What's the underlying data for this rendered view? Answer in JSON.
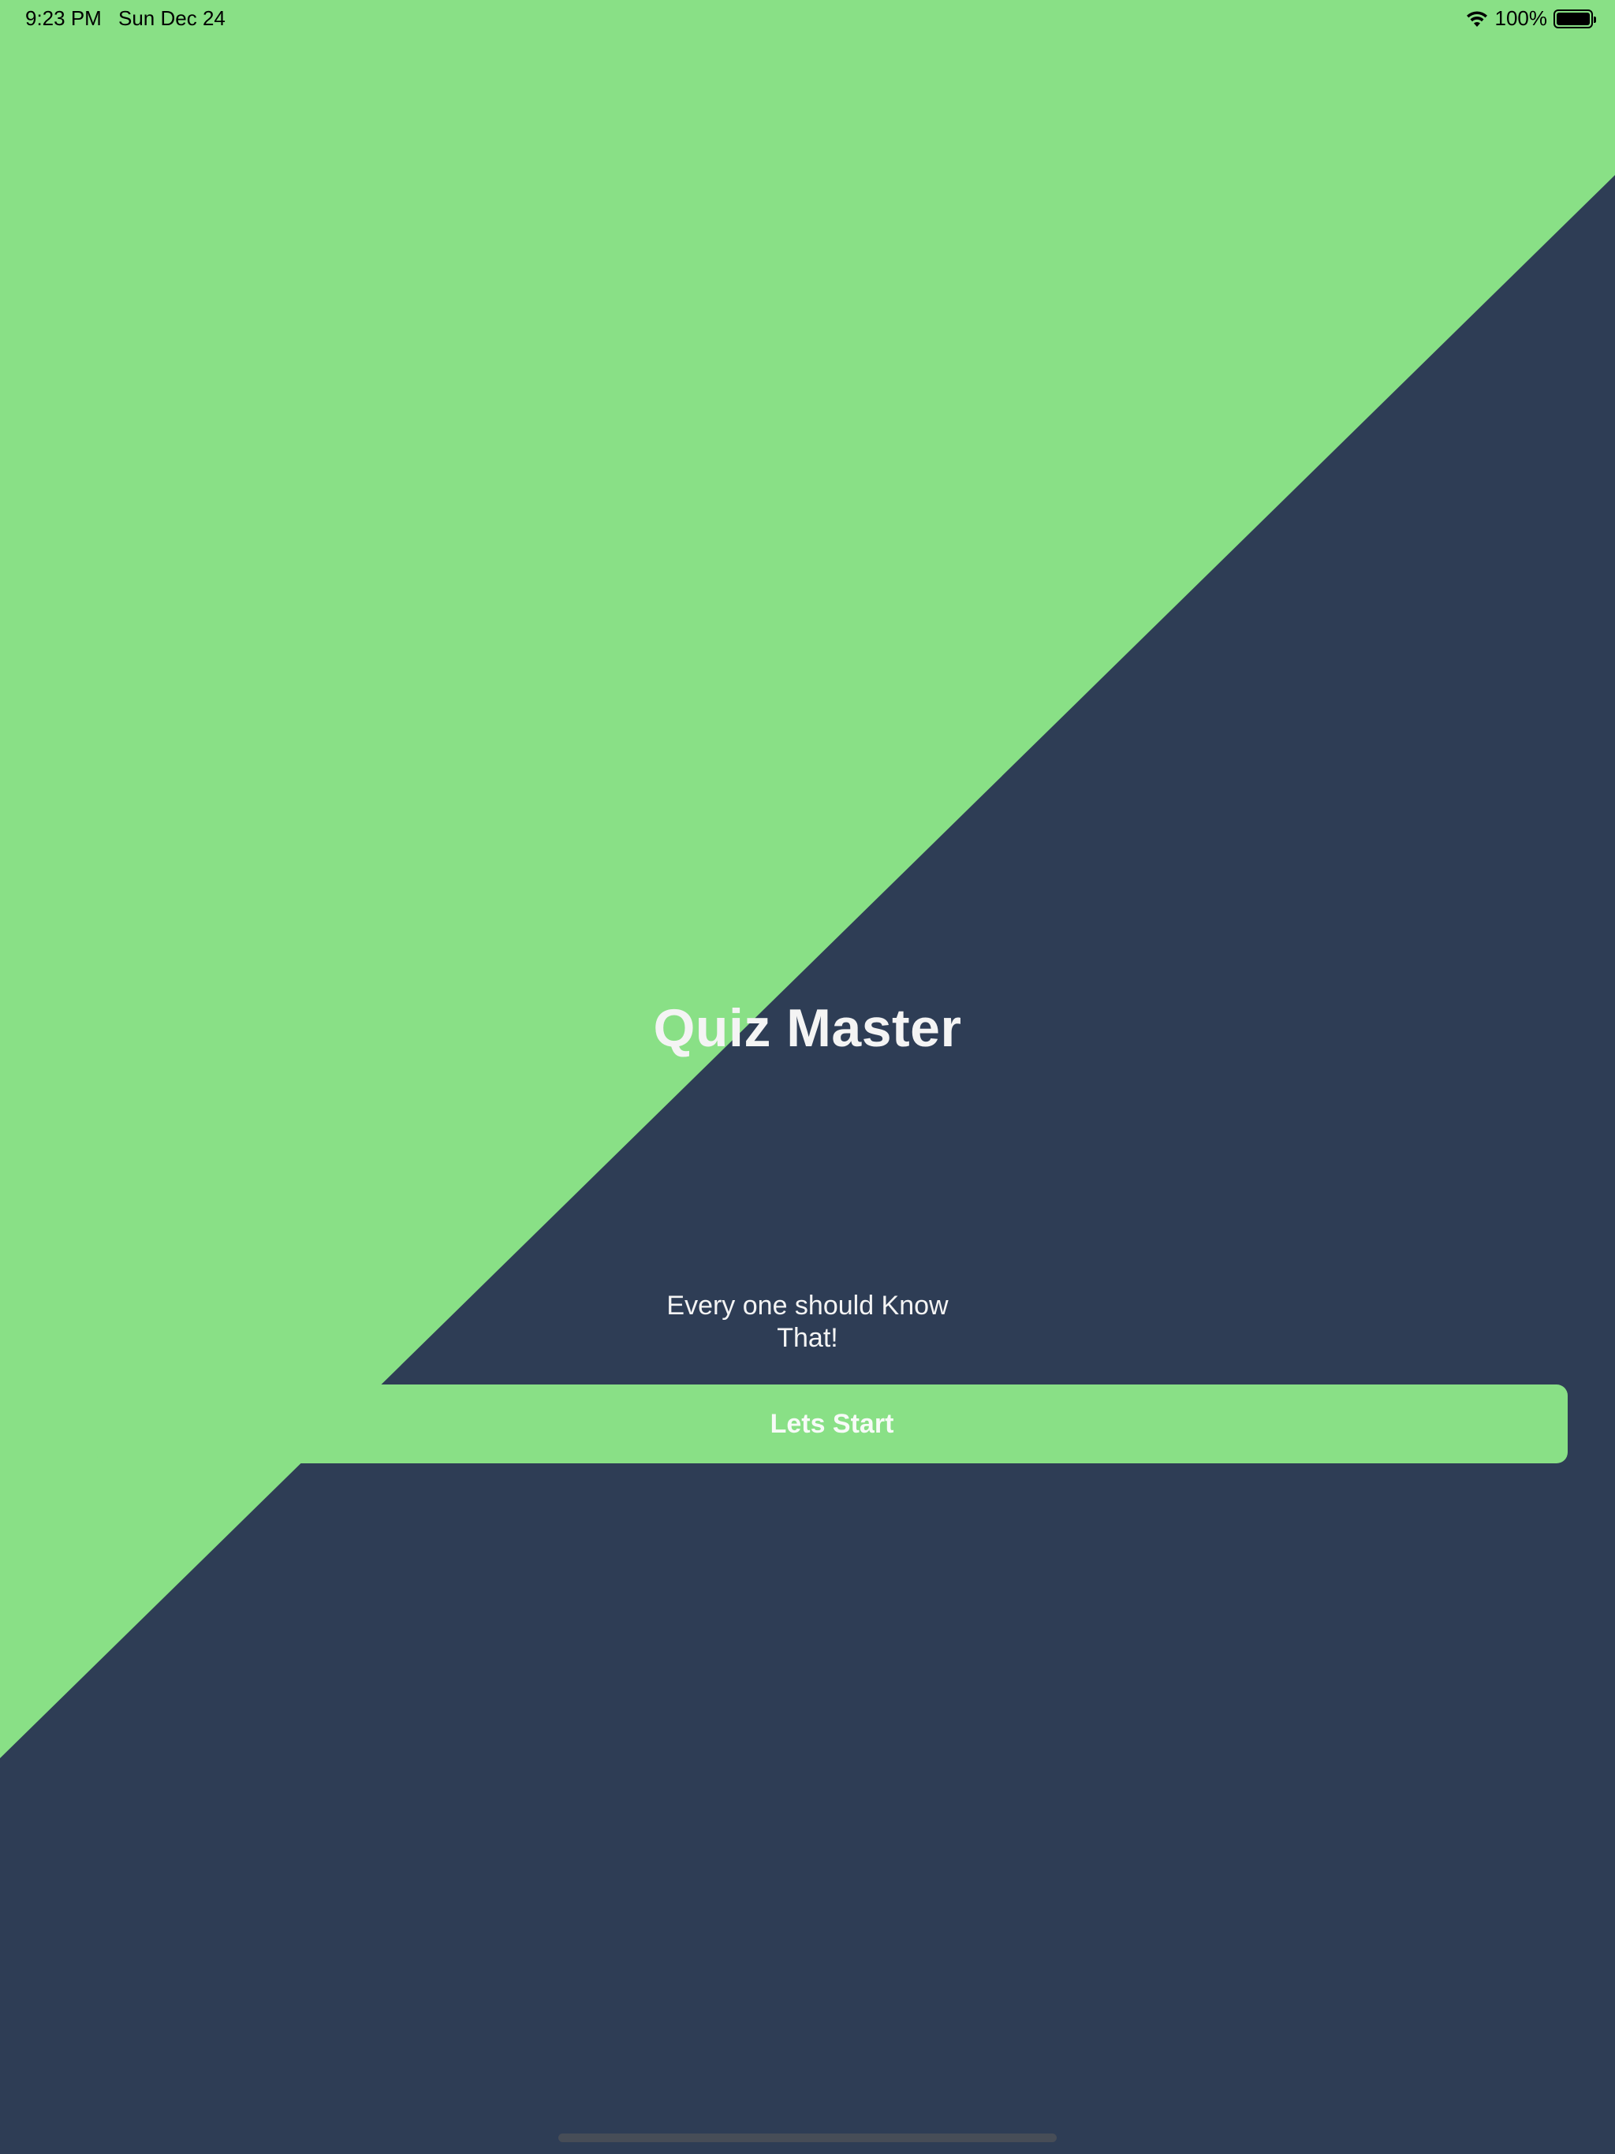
{
  "status_bar": {
    "time": "9:23 PM",
    "date": "Sun Dec 24",
    "battery": "100%",
    "icons": [
      "wifi-icon",
      "battery-icon"
    ]
  },
  "colors": {
    "green": "#89e086",
    "navy": "#2e3d55",
    "text": "#f4f4f4"
  },
  "main": {
    "title": "Quiz Master",
    "subtitle_line1": "Every one should Know",
    "subtitle_line2": "That!",
    "start_label": "Lets Start"
  }
}
